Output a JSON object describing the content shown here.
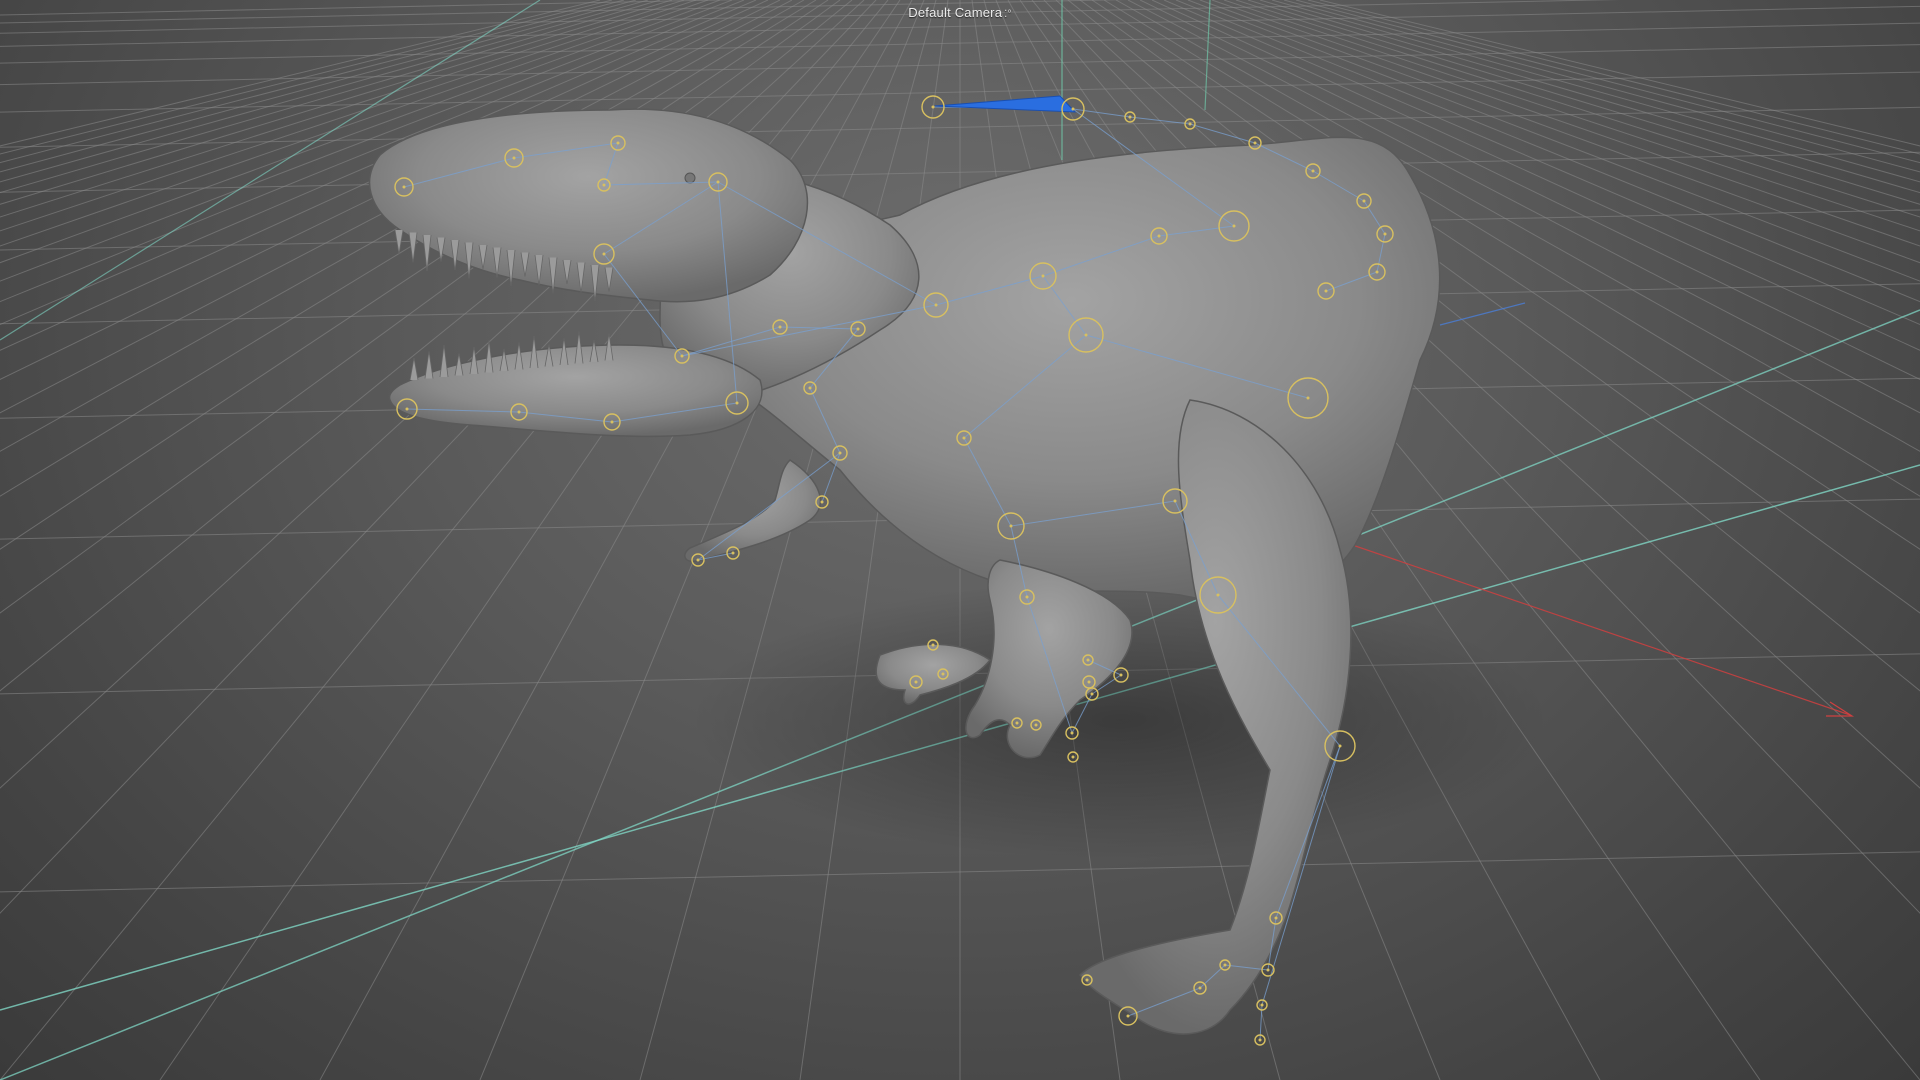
{
  "viewport": {
    "camera_label": "Default Camera",
    "camera_icon": "camera-dots-icon",
    "colors": {
      "background_center": "#6e6e6e",
      "background_edge": "#3a3a3a",
      "grid_line": "#8a8a8a",
      "axis_x": "#d04040",
      "axis_z": "#7fd6c4",
      "axis_y": "#6fc6a8",
      "model_surface": "#8c8c8c",
      "joint_ring": "#d8c060",
      "bone_line": "#7aa0d0",
      "selected_bone": "#2a6ee0"
    }
  }
}
